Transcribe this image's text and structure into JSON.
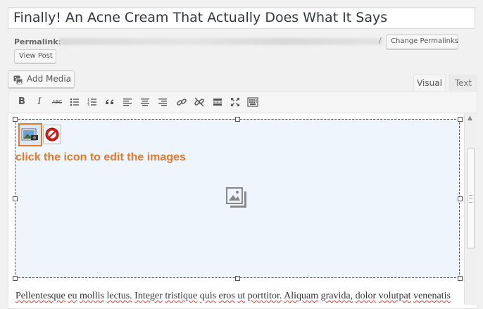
{
  "post": {
    "title": "Finally! An Acne Cream That Actually Does What It Says"
  },
  "permalink": {
    "label": "Permalink:",
    "slash": "/",
    "change_button": "Change Permalinks",
    "view_button": "View Post"
  },
  "media": {
    "add_media_label": "Add Media"
  },
  "editor_tabs": {
    "visual": "Visual",
    "text": "Text",
    "active": "visual"
  },
  "toolbar": {
    "bold": "B",
    "italic": "I",
    "strikethrough": "ABC",
    "icons": [
      "bold-icon",
      "italic-icon",
      "strikethrough-icon",
      "bullet-list-icon",
      "numbered-list-icon",
      "blockquote-icon",
      "align-left-icon",
      "align-center-icon",
      "align-right-icon",
      "link-icon",
      "unlink-icon",
      "read-more-icon",
      "fullscreen-icon",
      "toolbar-toggle-icon"
    ]
  },
  "gallery": {
    "note": "click the icon to edit the images",
    "edit_icon": "edit-gallery-icon",
    "remove_icon": "remove-gallery-icon",
    "placeholder_icon": "gallery-placeholder-icon"
  },
  "content": {
    "paragraph_words": [
      "Pellentesque",
      "eu",
      "mollis",
      "lectus.",
      "Integer",
      "tristique",
      "quis",
      "eros",
      "ut",
      "porttitor.",
      "Aliquam",
      "gravida,",
      "dolor",
      "volutpat",
      "venenatis"
    ]
  },
  "colors": {
    "accent_orange": "#e07a2e",
    "gallery_bg": "#eef5fd",
    "toolbar_bg": "#f5f5f5"
  }
}
